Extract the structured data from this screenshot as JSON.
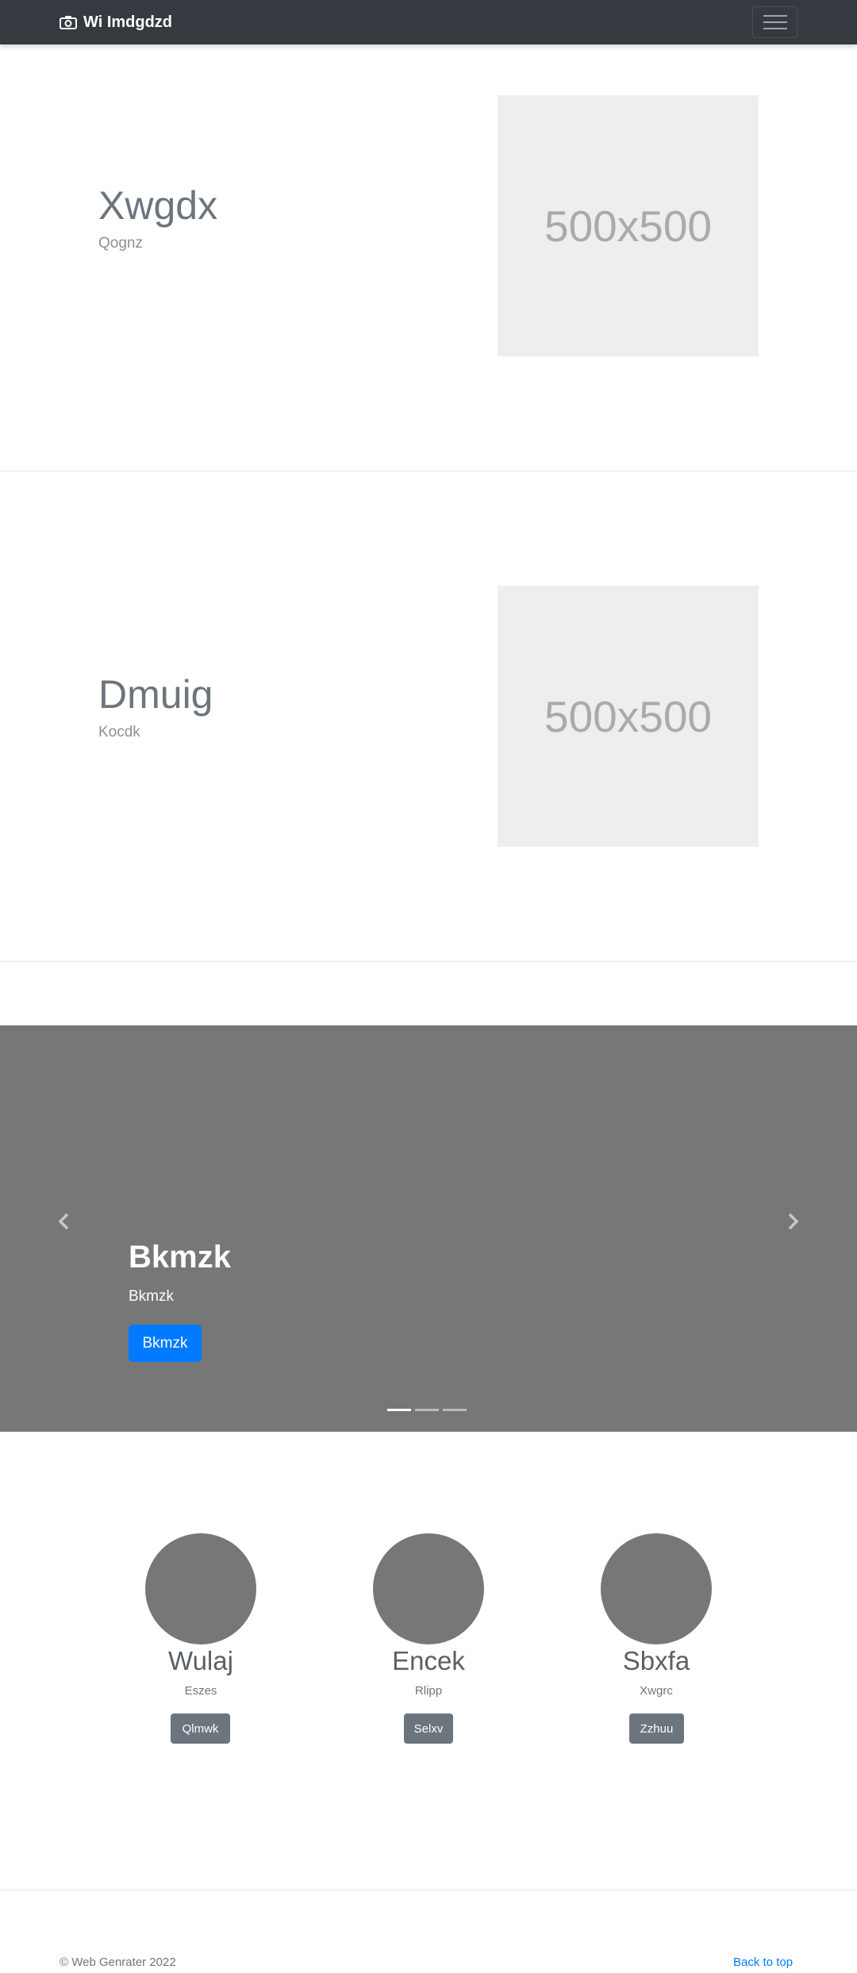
{
  "navbar": {
    "brand": "Wi Imdgdzd",
    "brand_icon": "camera-icon",
    "toggler_icon": "hamburger-icon"
  },
  "features": [
    {
      "heading": "Xwgdx",
      "subheading": "Qognz",
      "image_label": "500x500"
    },
    {
      "heading": "Dmuig",
      "subheading": "Kocdk",
      "image_label": "500x500"
    }
  ],
  "carousel": {
    "title": "Bkmzk",
    "text": "Bkmzk",
    "button_label": "Bkmzk",
    "prev_icon": "chevron-left-icon",
    "next_icon": "chevron-right-icon",
    "slide_count": 3,
    "active_slide": 1
  },
  "cards": [
    {
      "name": "Wulaj",
      "desc": "Eszes",
      "button": "Qlmwk"
    },
    {
      "name": "Encek",
      "desc": "Rlipp",
      "button": "Selxv"
    },
    {
      "name": "Sbxfa",
      "desc": "Xwgrc",
      "button": "Zzhuu"
    }
  ],
  "footer": {
    "copyright": "© Web Genrater 2022",
    "back_to_top": "Back to top"
  },
  "colors": {
    "navbar": "#343a40",
    "primary": "#007bff",
    "secondary": "#6c757d",
    "carousel_bg": "#777777",
    "placeholder_bg": "#eeeeee"
  }
}
